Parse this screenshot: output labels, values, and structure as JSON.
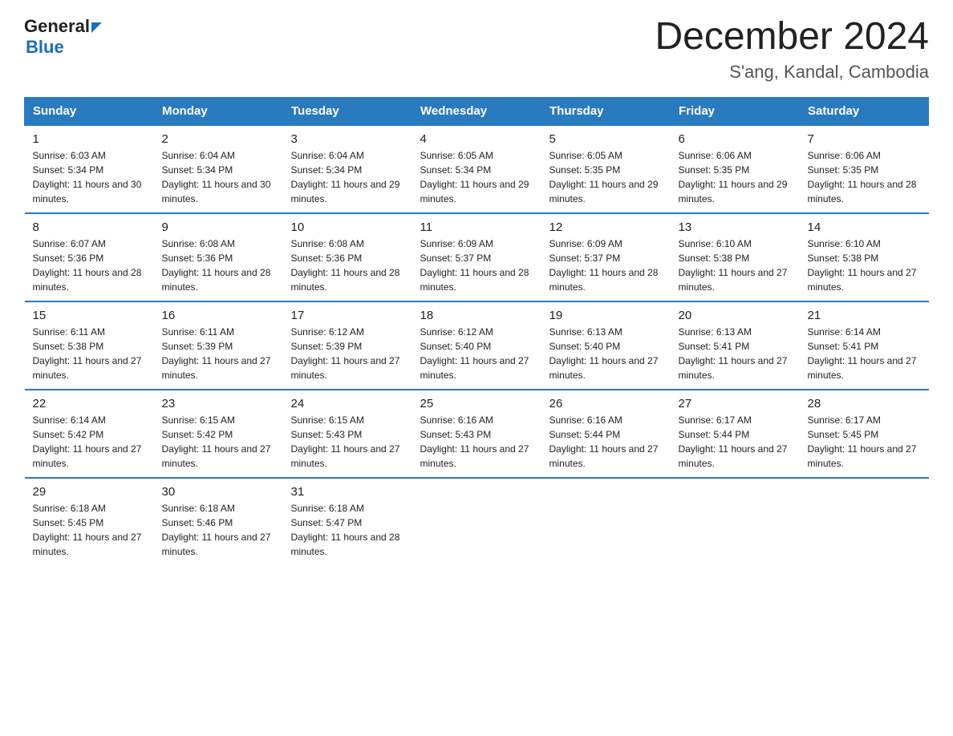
{
  "header": {
    "logo_general": "General",
    "logo_blue": "Blue",
    "title": "December 2024",
    "subtitle": "S'ang, Kandal, Cambodia"
  },
  "columns": [
    "Sunday",
    "Monday",
    "Tuesday",
    "Wednesday",
    "Thursday",
    "Friday",
    "Saturday"
  ],
  "weeks": [
    [
      {
        "day": "1",
        "sunrise": "6:03 AM",
        "sunset": "5:34 PM",
        "daylight": "11 hours and 30 minutes."
      },
      {
        "day": "2",
        "sunrise": "6:04 AM",
        "sunset": "5:34 PM",
        "daylight": "11 hours and 30 minutes."
      },
      {
        "day": "3",
        "sunrise": "6:04 AM",
        "sunset": "5:34 PM",
        "daylight": "11 hours and 29 minutes."
      },
      {
        "day": "4",
        "sunrise": "6:05 AM",
        "sunset": "5:34 PM",
        "daylight": "11 hours and 29 minutes."
      },
      {
        "day": "5",
        "sunrise": "6:05 AM",
        "sunset": "5:35 PM",
        "daylight": "11 hours and 29 minutes."
      },
      {
        "day": "6",
        "sunrise": "6:06 AM",
        "sunset": "5:35 PM",
        "daylight": "11 hours and 29 minutes."
      },
      {
        "day": "7",
        "sunrise": "6:06 AM",
        "sunset": "5:35 PM",
        "daylight": "11 hours and 28 minutes."
      }
    ],
    [
      {
        "day": "8",
        "sunrise": "6:07 AM",
        "sunset": "5:36 PM",
        "daylight": "11 hours and 28 minutes."
      },
      {
        "day": "9",
        "sunrise": "6:08 AM",
        "sunset": "5:36 PM",
        "daylight": "11 hours and 28 minutes."
      },
      {
        "day": "10",
        "sunrise": "6:08 AM",
        "sunset": "5:36 PM",
        "daylight": "11 hours and 28 minutes."
      },
      {
        "day": "11",
        "sunrise": "6:09 AM",
        "sunset": "5:37 PM",
        "daylight": "11 hours and 28 minutes."
      },
      {
        "day": "12",
        "sunrise": "6:09 AM",
        "sunset": "5:37 PM",
        "daylight": "11 hours and 28 minutes."
      },
      {
        "day": "13",
        "sunrise": "6:10 AM",
        "sunset": "5:38 PM",
        "daylight": "11 hours and 27 minutes."
      },
      {
        "day": "14",
        "sunrise": "6:10 AM",
        "sunset": "5:38 PM",
        "daylight": "11 hours and 27 minutes."
      }
    ],
    [
      {
        "day": "15",
        "sunrise": "6:11 AM",
        "sunset": "5:38 PM",
        "daylight": "11 hours and 27 minutes."
      },
      {
        "day": "16",
        "sunrise": "6:11 AM",
        "sunset": "5:39 PM",
        "daylight": "11 hours and 27 minutes."
      },
      {
        "day": "17",
        "sunrise": "6:12 AM",
        "sunset": "5:39 PM",
        "daylight": "11 hours and 27 minutes."
      },
      {
        "day": "18",
        "sunrise": "6:12 AM",
        "sunset": "5:40 PM",
        "daylight": "11 hours and 27 minutes."
      },
      {
        "day": "19",
        "sunrise": "6:13 AM",
        "sunset": "5:40 PM",
        "daylight": "11 hours and 27 minutes."
      },
      {
        "day": "20",
        "sunrise": "6:13 AM",
        "sunset": "5:41 PM",
        "daylight": "11 hours and 27 minutes."
      },
      {
        "day": "21",
        "sunrise": "6:14 AM",
        "sunset": "5:41 PM",
        "daylight": "11 hours and 27 minutes."
      }
    ],
    [
      {
        "day": "22",
        "sunrise": "6:14 AM",
        "sunset": "5:42 PM",
        "daylight": "11 hours and 27 minutes."
      },
      {
        "day": "23",
        "sunrise": "6:15 AM",
        "sunset": "5:42 PM",
        "daylight": "11 hours and 27 minutes."
      },
      {
        "day": "24",
        "sunrise": "6:15 AM",
        "sunset": "5:43 PM",
        "daylight": "11 hours and 27 minutes."
      },
      {
        "day": "25",
        "sunrise": "6:16 AM",
        "sunset": "5:43 PM",
        "daylight": "11 hours and 27 minutes."
      },
      {
        "day": "26",
        "sunrise": "6:16 AM",
        "sunset": "5:44 PM",
        "daylight": "11 hours and 27 minutes."
      },
      {
        "day": "27",
        "sunrise": "6:17 AM",
        "sunset": "5:44 PM",
        "daylight": "11 hours and 27 minutes."
      },
      {
        "day": "28",
        "sunrise": "6:17 AM",
        "sunset": "5:45 PM",
        "daylight": "11 hours and 27 minutes."
      }
    ],
    [
      {
        "day": "29",
        "sunrise": "6:18 AM",
        "sunset": "5:45 PM",
        "daylight": "11 hours and 27 minutes."
      },
      {
        "day": "30",
        "sunrise": "6:18 AM",
        "sunset": "5:46 PM",
        "daylight": "11 hours and 27 minutes."
      },
      {
        "day": "31",
        "sunrise": "6:18 AM",
        "sunset": "5:47 PM",
        "daylight": "11 hours and 28 minutes."
      },
      null,
      null,
      null,
      null
    ]
  ]
}
